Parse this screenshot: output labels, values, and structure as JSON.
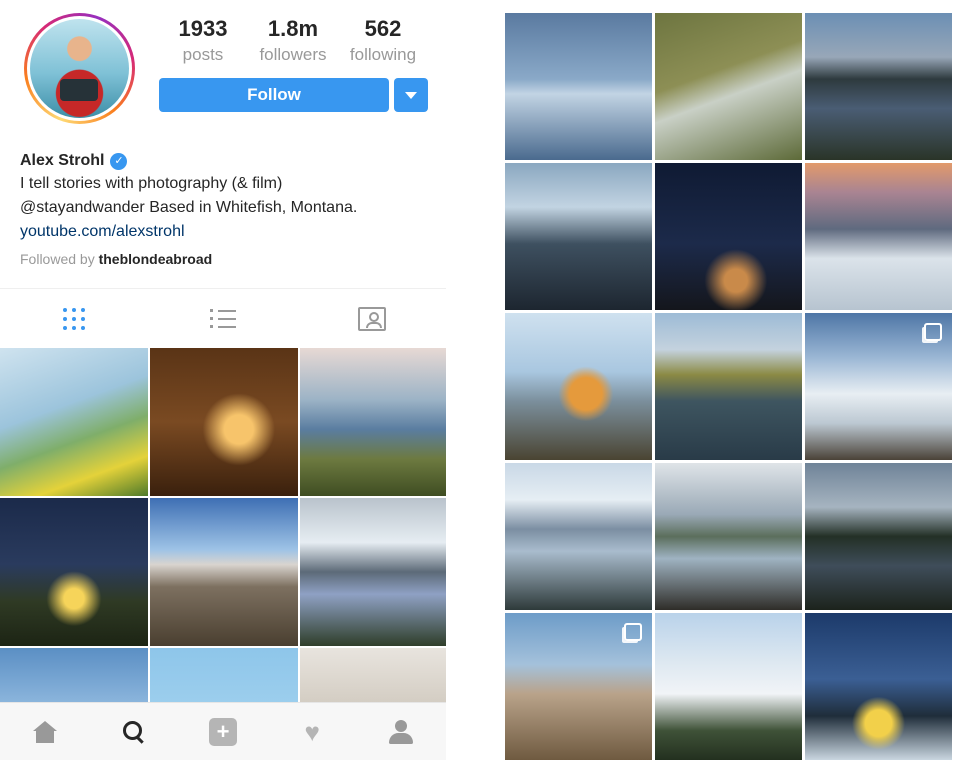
{
  "profile": {
    "name": "Alex Strohl",
    "bio_line1": "I tell stories with photography (& film)",
    "bio_line2": "@stayandwander Based in Whitefish, Montana.",
    "link": "youtube.com/alexstrohl",
    "followed_by_prefix": "Followed by ",
    "followed_by_user": "theblondeabroad",
    "verified_glyph": "✓"
  },
  "stats": {
    "posts_count": "1933",
    "posts_label": "posts",
    "followers_count": "1.8m",
    "followers_label": "followers",
    "following_count": "562",
    "following_label": "following"
  },
  "actions": {
    "follow_label": "Follow",
    "dropdown_icon": "chevron-down-icon"
  },
  "tabs": [
    {
      "name": "grid",
      "icon": "grid-icon",
      "active": true
    },
    {
      "name": "list",
      "icon": "list-icon",
      "active": false
    },
    {
      "name": "tagged",
      "icon": "tagged-icon",
      "active": false
    }
  ],
  "bottom_nav": [
    {
      "name": "home",
      "icon": "home-icon"
    },
    {
      "name": "search",
      "icon": "search-icon",
      "active": true
    },
    {
      "name": "new-post",
      "icon": "plus-icon",
      "glyph": "+"
    },
    {
      "name": "activity",
      "icon": "heart-icon",
      "glyph": "♥"
    },
    {
      "name": "profile",
      "icon": "profile-icon"
    }
  ],
  "colors": {
    "accent": "#3897f0",
    "link": "#003569",
    "muted": "#999999"
  },
  "left_photos": [
    {
      "subject": "coast flowers",
      "bg": "linear-gradient(160deg,#cfe3ef 0%,#9cc4dc 40%,#7fae6a 60%,#e4d23a 80%,#4f7a2a 100%)"
    },
    {
      "subject": "cabin interior",
      "bg": "radial-gradient(circle at 60% 55%,#f7c46b 0 12%,transparent 30%),linear-gradient(180deg,#5a3416 0%,#7a4a22 50%,#3a200d 100%)"
    },
    {
      "subject": "cliff coastline",
      "bg": "linear-gradient(180deg,#e7d9d4 0%,#9cb3c6 35%,#5a7da0 55%,#6d7a40 75%,#3f4d22 100%)"
    },
    {
      "subject": "night tent",
      "bg": "radial-gradient(circle at 50% 68%,#f6d45a 0 8%,transparent 22%),linear-gradient(180deg,#1b2a4a 0%,#2a3b5e 45%,#2f3a24 70%,#1c2414 100%)"
    },
    {
      "subject": "desert mountains",
      "bg": "linear-gradient(180deg,#3e6fb4 0%,#9ec3e6 35%,#d9d4cf 45%,#7d7060 60%,#4a3f30 100%)"
    },
    {
      "subject": "mountain lake",
      "bg": "linear-gradient(180deg,#b9c3cc 0%,#e6edf2 30%,#5c6a78 50%,#8fa1c4 65%,#2f3e2a 100%)"
    },
    {
      "subject": "rock dome",
      "bg": "linear-gradient(180deg,#5b8fc4 0%,#8fb8de 40%,#4a3010 60%,#caa24f 100%)"
    },
    {
      "subject": "blue sky",
      "bg": "linear-gradient(180deg,#8ec6ea 0%,#b3dbf2 100%)"
    },
    {
      "subject": "valley",
      "bg": "linear-gradient(180deg,#e8e4de 0%,#cfc8bd 45%,#8a7a62 75%,#6a5a44 100%)"
    }
  ],
  "right_photos": [
    {
      "subject": "misty lake",
      "bg": "linear-gradient(180deg,#5a7aa0 0%,#8aa9c8 45%,#c2d4e4 55%,#4a6a8e 100%)",
      "multi": false
    },
    {
      "subject": "aerial stream",
      "bg": "linear-gradient(160deg,#6d7540 0%,#8d8f55 40%,#c9d0c6 55%,#5d6a38 100%)",
      "multi": false
    },
    {
      "subject": "dusk pond",
      "bg": "linear-gradient(180deg,#6b8fb4 0%,#98a7b8 30%,#2e3a3e 45%,#4a5d74 65%,#2a3428 100%)",
      "multi": false
    },
    {
      "subject": "headlamp road",
      "bg": "linear-gradient(180deg,#8aa7c0 0%,#c2d4e2 30%,#3e5060 55%,#1d2630 100%)",
      "multi": false
    },
    {
      "subject": "starry cabin",
      "bg": "radial-gradient(circle at 55% 80%,#c98a4a 0 8%,transparent 22%),linear-gradient(180deg,#0f1a33 0%,#1c2a4a 55%,#14161c 100%)",
      "multi": false
    },
    {
      "subject": "sunset snow hike",
      "bg": "linear-gradient(180deg,#e29a6b 0%,#a98492 20%,#5f6a7f 45%,#dbe3ea 65%,#b7c4d0 100%)",
      "multi": false
    },
    {
      "subject": "orange tent",
      "bg": "radial-gradient(circle at 55% 55%,#e59a3c 0 14%,transparent 24%),linear-gradient(180deg,#cfe1ef 0%,#a9c7e0 40%,#7b8f9c 60%,#4a4432 100%)",
      "multi": false
    },
    {
      "subject": "forest lake",
      "bg": "linear-gradient(180deg,#9dbbd6 0%,#c4d2de 25%,#8b8a44 42%,#3e5560 60%,#293b48 100%)",
      "multi": false
    },
    {
      "subject": "snowy shore",
      "bg": "linear-gradient(180deg,#4e76a6 0%,#9ab6d4 30%,#e8eef3 55%,#bcc8d2 75%,#4a4238 100%)",
      "multi": true
    },
    {
      "subject": "reflection lake",
      "bg": "linear-gradient(180deg,#c9d8e6 0%,#e6eef4 25%,#7b8ea2 45%,#a9bccd 60%,#2e3a3a 100%)",
      "multi": false
    },
    {
      "subject": "kayak fjord",
      "bg": "linear-gradient(180deg,#dfe4e8 0%,#9aa9b6 35%,#5b6e5c 50%,#9fb3c2 65%,#2f2d28 100%)",
      "multi": false
    },
    {
      "subject": "dark valley lake",
      "bg": "linear-gradient(180deg,#6f8398 0%,#a6b4c0 30%,#233026 50%,#3f4d5a 70%,#1c231c 100%)",
      "multi": false
    },
    {
      "subject": "rock arch",
      "bg": "linear-gradient(180deg,#6d9cc8 0%,#a4c1db 35%,#b9a38a 55%,#6f5a40 100%)",
      "multi": true
    },
    {
      "subject": "cloud sea",
      "bg": "linear-gradient(180deg,#b9d2ea 0%,#dfe9f1 35%,#f1f4f7 55%,#3f5238 80%,#23301f 100%)",
      "multi": false
    },
    {
      "subject": "yellow camper",
      "bg": "radial-gradient(circle at 50% 75%,#f2d04a 0 10%,transparent 20%),linear-gradient(180deg,#1c3a6a 0%,#3b5f94 45%,#1f2d3a 70%,#c9d6e0 100%)",
      "multi": false
    }
  ]
}
